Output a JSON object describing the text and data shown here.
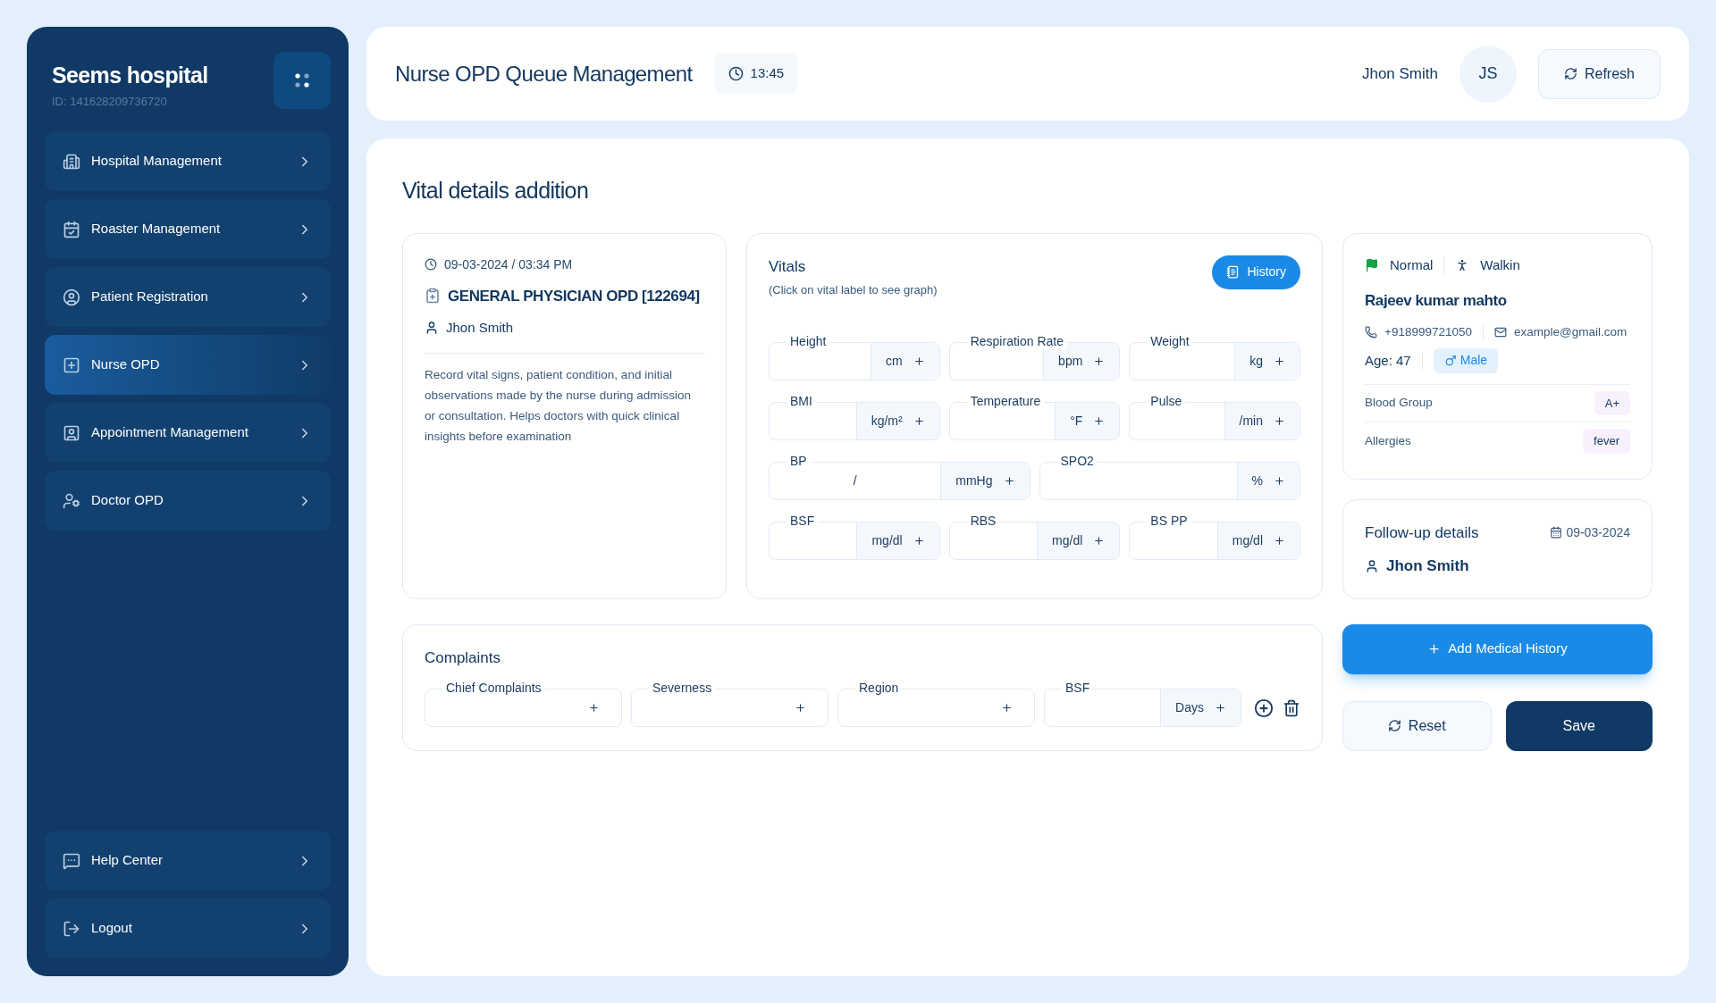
{
  "sidebar": {
    "brand": "Seems hospital",
    "id": "ID: 141628209736720",
    "items": [
      {
        "label": "Hospital Management",
        "kind": "hospital",
        "selected": false
      },
      {
        "label": "Roaster Management",
        "kind": "roster",
        "selected": false
      },
      {
        "label": "Patient Registration",
        "kind": "patient",
        "selected": false
      },
      {
        "label": "Nurse OPD",
        "kind": "nurse",
        "selected": true
      },
      {
        "label": "Appointment Management",
        "kind": "appointment",
        "selected": false
      },
      {
        "label": "Doctor OPD",
        "kind": "doctor",
        "selected": false
      }
    ],
    "bottom_items": [
      {
        "label": "Help Center",
        "kind": "help",
        "selected": false
      },
      {
        "label": "Logout",
        "kind": "logout",
        "selected": false
      }
    ]
  },
  "header": {
    "title": "Nurse OPD Queue Management",
    "time": "13:45",
    "user": "Jhon Smith",
    "avatar": "JS",
    "refresh": "Refresh"
  },
  "page_title": "Vital details addition",
  "visit": {
    "datetime": "09-03-2024 / 03:34 PM",
    "department": "GENERAL PHYSICIAN OPD [122694]",
    "nurse": "Jhon Smith",
    "description": "Record vital signs, patient condition, and initial observations made by the nurse during admission or consultation. Helps doctors with quick clinical insights before examination"
  },
  "vitals": {
    "title": "Vitals",
    "hint": "(Click on vital label to see graph)",
    "history": "History",
    "rows": [
      [
        {
          "label": "Height",
          "unit": "cm"
        },
        {
          "label": "Respiration Rate",
          "unit": "bpm"
        },
        {
          "label": "Weight",
          "unit": "kg"
        }
      ],
      [
        {
          "label": "BMI",
          "unit": "kg/m²"
        },
        {
          "label": "Temperature",
          "unit": "°F"
        },
        {
          "label": "Pulse",
          "unit": "/min"
        }
      ],
      [
        {
          "label": "BP",
          "unit": "mmHg",
          "separator": "/"
        },
        {
          "label": "SPO2",
          "unit": "%"
        }
      ],
      [
        {
          "label": "BSF",
          "unit": "mg/dl"
        },
        {
          "label": "RBS",
          "unit": "mg/dl"
        },
        {
          "label": "BS PP",
          "unit": "mg/dl"
        }
      ]
    ]
  },
  "patient": {
    "priority": {
      "label": "Normal",
      "color": "#16a34a"
    },
    "visit_type": "Walkin",
    "name": "Rajeev kumar mahto",
    "phone": "+918999721050",
    "email": "example@gmail.com",
    "age": "Age: 47",
    "gender": "Male",
    "details": [
      {
        "label": "Blood Group",
        "value": "A+"
      },
      {
        "label": "Allergies",
        "value": "fever"
      }
    ]
  },
  "follow_up": {
    "title": "Follow-up details",
    "date": "09-03-2024",
    "doctor": "Jhon Smith"
  },
  "complaints": {
    "title": "Complaints",
    "fields": [
      {
        "label": "Chief Complaints"
      },
      {
        "label": "Severness"
      },
      {
        "label": "Region"
      },
      {
        "label": "BSF",
        "unit": "Days"
      }
    ]
  },
  "actions": {
    "add_history": "Add Medical History",
    "reset": "Reset",
    "save": "Save"
  }
}
